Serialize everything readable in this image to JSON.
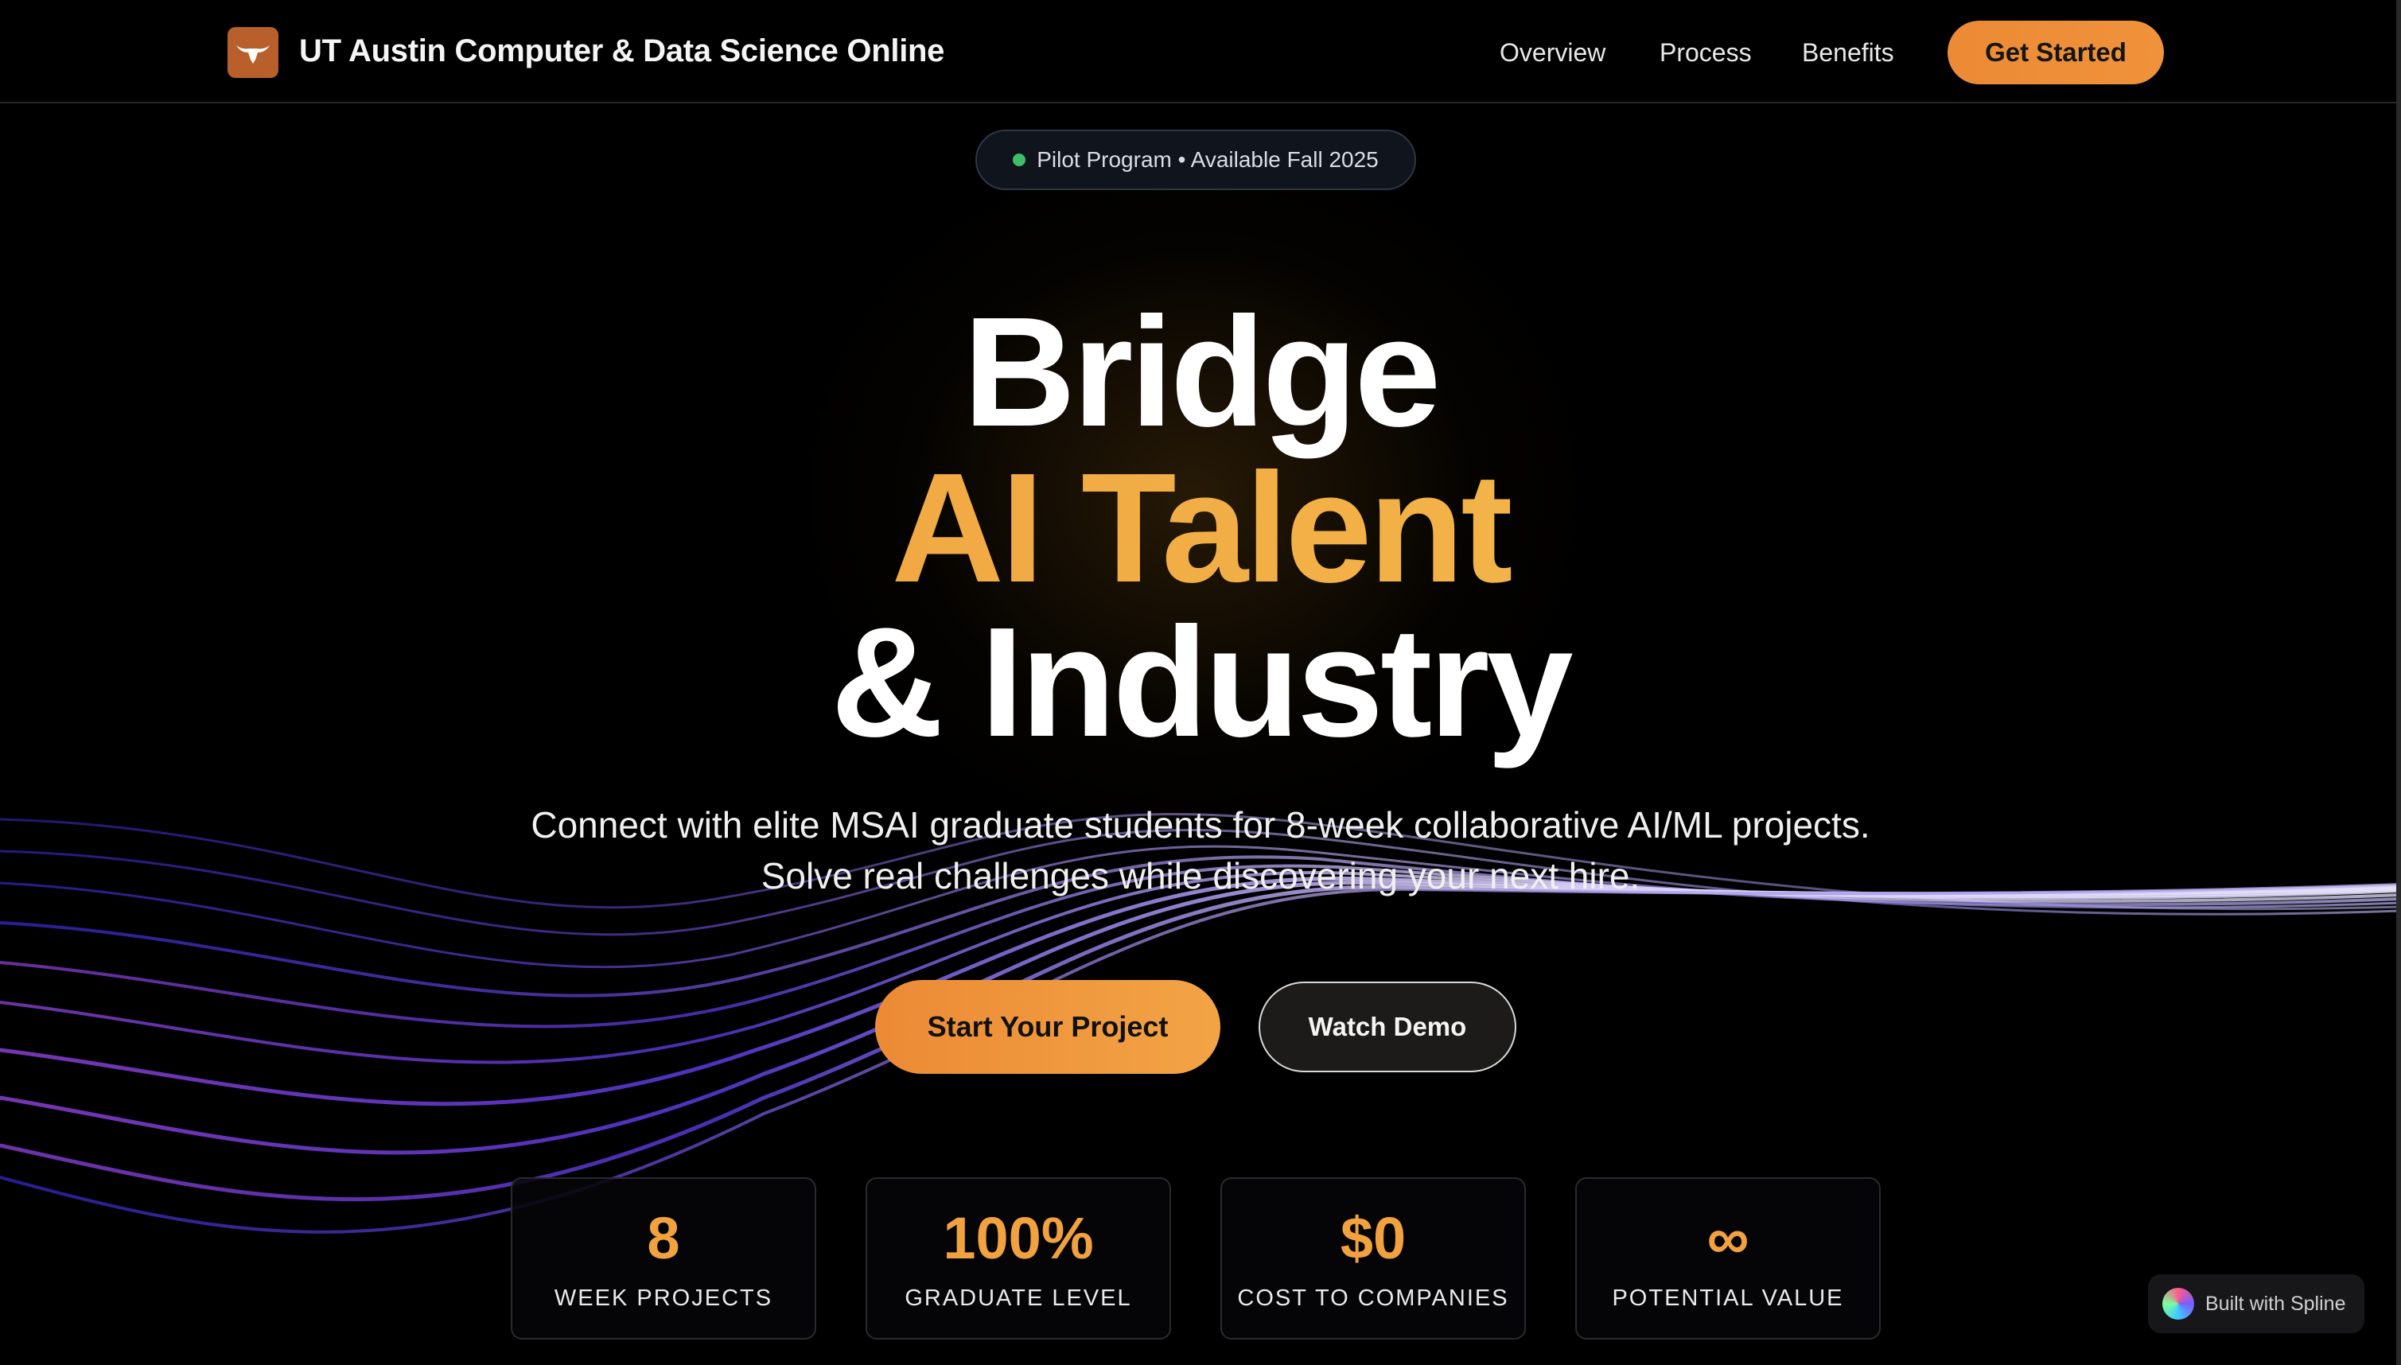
{
  "nav": {
    "brand": "UT Austin Computer & Data Science Online",
    "links": [
      "Overview",
      "Process",
      "Benefits"
    ],
    "cta": "Get Started"
  },
  "badge": {
    "text": "Pilot Program • Available Fall 2025",
    "status_color": "#3fbe6a"
  },
  "hero": {
    "line1": "Bridge",
    "line2": "AI Talent",
    "line3": "& Industry",
    "subtitle_line1": "Connect with elite MSAI graduate students for 8-week collaborative AI/ML projects.",
    "subtitle_line2": "Solve real challenges while discovering your next hire.",
    "primary_button": "Start Your Project",
    "secondary_button": "Watch Demo"
  },
  "stats": [
    {
      "value": "8",
      "label": "WEEK PROJECTS"
    },
    {
      "value": "100%",
      "label": "GRADUATE LEVEL"
    },
    {
      "value": "$0",
      "label": "COST TO COMPANIES"
    },
    {
      "value": "∞",
      "label": "POTENTIAL VALUE"
    }
  ],
  "spline_badge": "Built with Spline",
  "colors": {
    "accent_orange": "#ec8a35",
    "accent_gold": "#f4c24f",
    "background": "#000000"
  },
  "icons": [
    "longhorn-icon",
    "spline-logo-icon"
  ]
}
